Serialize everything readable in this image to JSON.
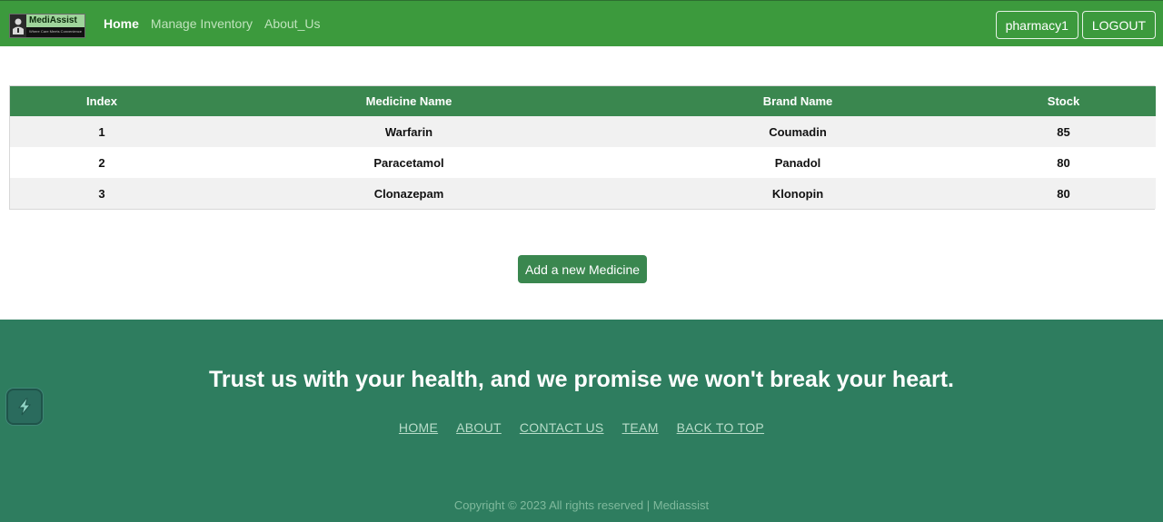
{
  "brand": {
    "name": "MediAssist",
    "tagline": "Where Care Meets Convenience"
  },
  "nav": {
    "links": [
      {
        "label": "Home",
        "active": true
      },
      {
        "label": "Manage Inventory",
        "active": false
      },
      {
        "label": "About_Us",
        "active": false
      }
    ],
    "user_label": "pharmacy1",
    "logout_label": "LOGOUT"
  },
  "table": {
    "headers": [
      "Index",
      "Medicine Name",
      "Brand Name",
      "Stock"
    ],
    "rows": [
      [
        "1",
        "Warfarin",
        "Coumadin",
        "85"
      ],
      [
        "2",
        "Paracetamol",
        "Panadol",
        "80"
      ],
      [
        "3",
        "Clonazepam",
        "Klonopin",
        "80"
      ]
    ]
  },
  "add_button_label": "Add a new Medicine",
  "footer": {
    "tagline": "Trust us with your health, and we promise we won't break your heart.",
    "links": [
      "HOME",
      "ABOUT",
      "CONTACT US",
      "TEAM",
      "BACK TO TOP"
    ],
    "copyright": "Copyright © 2023 All rights reserved | Mediassist"
  },
  "colors": {
    "navbar": "#3c9a3d",
    "table_header": "#3a874f",
    "button": "#3a874f",
    "footer": "#2e7d5f"
  },
  "icons": {
    "brand_logo": "doctor-logo-icon",
    "floating_widget": "lightning-widget-icon"
  }
}
